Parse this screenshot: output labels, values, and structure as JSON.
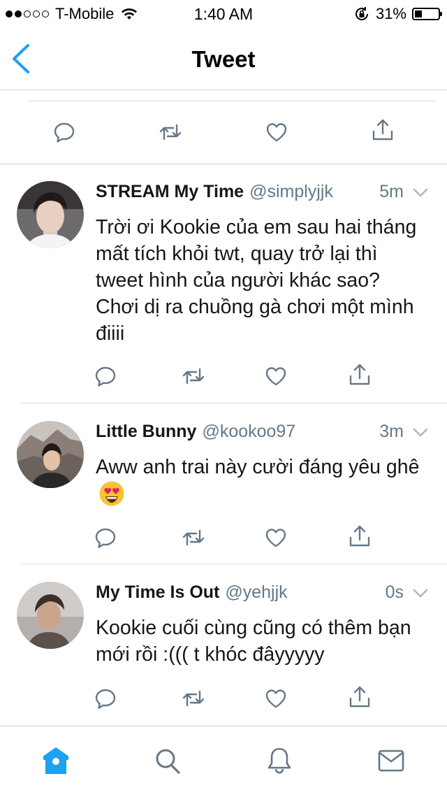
{
  "status_bar": {
    "carrier": "T-Mobile",
    "time": "1:40 AM",
    "battery": "31%",
    "battery_level": 0.31,
    "signal_bars": 2
  },
  "nav": {
    "title": "Tweet",
    "back_icon": "chevron-left-icon",
    "accent_color": "#1da1f2"
  },
  "tweets": [
    {
      "name": "STREAM My Time",
      "handle": "@simplyjjk",
      "time": "5m",
      "text": "Trời ơi Kookie của em sau hai tháng mất tích khỏi twt, quay trở lại thì tweet hình của người khác sao? Chơi dị ra chuồng gà chơi một mình điiii"
    },
    {
      "name": "Little Bunny",
      "handle": "@kookoo97",
      "time": "3m",
      "text": "Aww anh trai này cười đáng yêu ghê",
      "emoji": "heart-eyes-emoji"
    },
    {
      "name": "My Time Is Out",
      "handle": "@yehjjk",
      "time": "0s",
      "text": "Kookie cuối cùng cũng có thêm bạn mới rồi :((( t khóc đâyyyyy"
    }
  ],
  "tab_bar": {
    "items": [
      "home-icon",
      "search-icon",
      "notifications-icon",
      "messages-icon"
    ],
    "active": "home-icon"
  },
  "colors": {
    "icon_gray": "#657786",
    "text_dark": "#14171a",
    "accent": "#1da1f2"
  }
}
